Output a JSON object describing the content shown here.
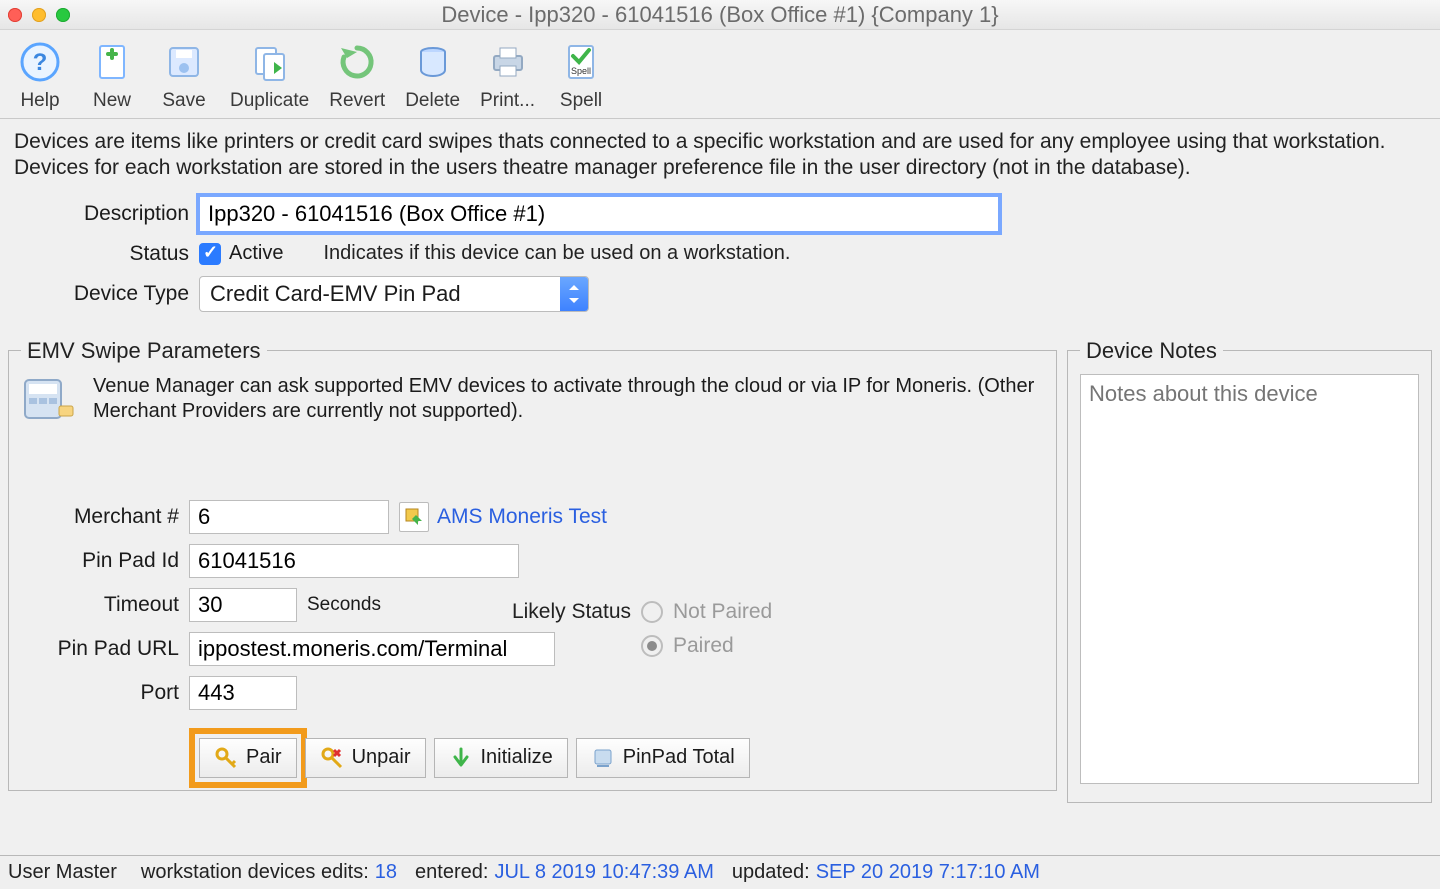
{
  "window": {
    "title": "Device - Ipp320 - 61041516 (Box Office #1) {Company 1}"
  },
  "toolbar": {
    "help": "Help",
    "new": "New",
    "save": "Save",
    "duplicate": "Duplicate",
    "revert": "Revert",
    "delete": "Delete",
    "print": "Print...",
    "spell": "Spell"
  },
  "info_text": "Devices are items like printers or credit card swipes thats connected to a specific workstation and are used for any employee using that workstation.  Devices for each workstation are stored in the users theatre manager preference file in the user directory (not in the database).",
  "form": {
    "description_label": "Description",
    "description_value": "Ipp320 - 61041516 (Box Office #1)",
    "status_label": "Status",
    "active_label": "Active",
    "active_checked": true,
    "status_hint": "Indicates if this device can be used on a workstation.",
    "device_type_label": "Device Type",
    "device_type_value": "Credit Card-EMV Pin Pad"
  },
  "emv": {
    "legend": "EMV Swipe Parameters",
    "intro": "Venue Manager can ask supported EMV devices to activate through the cloud or via IP for Moneris. (Other Merchant Providers are currently not supported).",
    "merchant_label": "Merchant #",
    "merchant_value": "6",
    "merchant_link": "AMS Moneris Test",
    "pinpad_id_label": "Pin Pad Id",
    "pinpad_id_value": "61041516",
    "timeout_label": "Timeout",
    "timeout_value": "30",
    "timeout_unit": "Seconds",
    "url_label": "Pin Pad URL",
    "url_value": "ippostest.moneris.com/Terminal",
    "port_label": "Port",
    "port_value": "443",
    "likely_status_label": "Likely Status",
    "status_not_paired": "Not Paired",
    "status_paired": "Paired",
    "buttons": {
      "pair": "Pair",
      "unpair": "Unpair",
      "initialize": "Initialize",
      "pinpad_total": "PinPad Total"
    }
  },
  "notes": {
    "legend": "Device Notes",
    "placeholder": "Notes about this device"
  },
  "footer": {
    "user_label": "User Master",
    "edits_label": "workstation devices edits:",
    "edits_value": "18",
    "entered_label": "entered:",
    "entered_value": "JUL 8 2019 10:47:39 AM",
    "updated_label": "updated:",
    "updated_value": "SEP 20 2019 7:17:10 AM"
  }
}
